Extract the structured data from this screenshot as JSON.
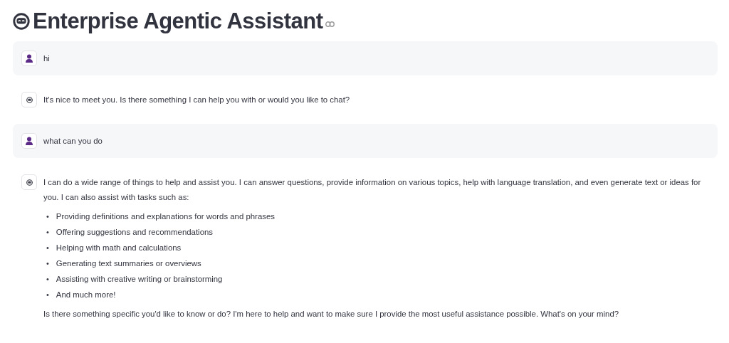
{
  "title": "Enterprise Agentic Assistant",
  "messages": [
    {
      "kind": "user",
      "blocks": [
        {
          "kind": "paragraph",
          "text": "hi"
        }
      ]
    },
    {
      "kind": "assistant",
      "blocks": [
        {
          "kind": "paragraph",
          "text": "It's nice to meet you. Is there something I can help you with or would you like to chat?"
        }
      ]
    },
    {
      "kind": "user",
      "blocks": [
        {
          "kind": "paragraph",
          "text": "what can you do"
        }
      ]
    },
    {
      "kind": "assistant",
      "blocks": [
        {
          "kind": "paragraph",
          "text": "I can do a wide range of things to help and assist you. I can answer questions, provide information on various topics, help with language translation, and even generate text or ideas for you. I can also assist with tasks such as:"
        },
        {
          "kind": "list",
          "marker": "•",
          "items": [
            "Providing definitions and explanations for words and phrases",
            "Offering suggestions and recommendations",
            "Helping with math and calculations",
            "Generating text summaries or overviews",
            "Assisting with creative writing or brainstorming",
            "And much more!"
          ]
        },
        {
          "kind": "paragraph",
          "text": "Is there something specific you'd like to know or do? I'm here to help and want to make sure I provide the most useful assistance possible. What's on your mind?"
        }
      ]
    }
  ]
}
